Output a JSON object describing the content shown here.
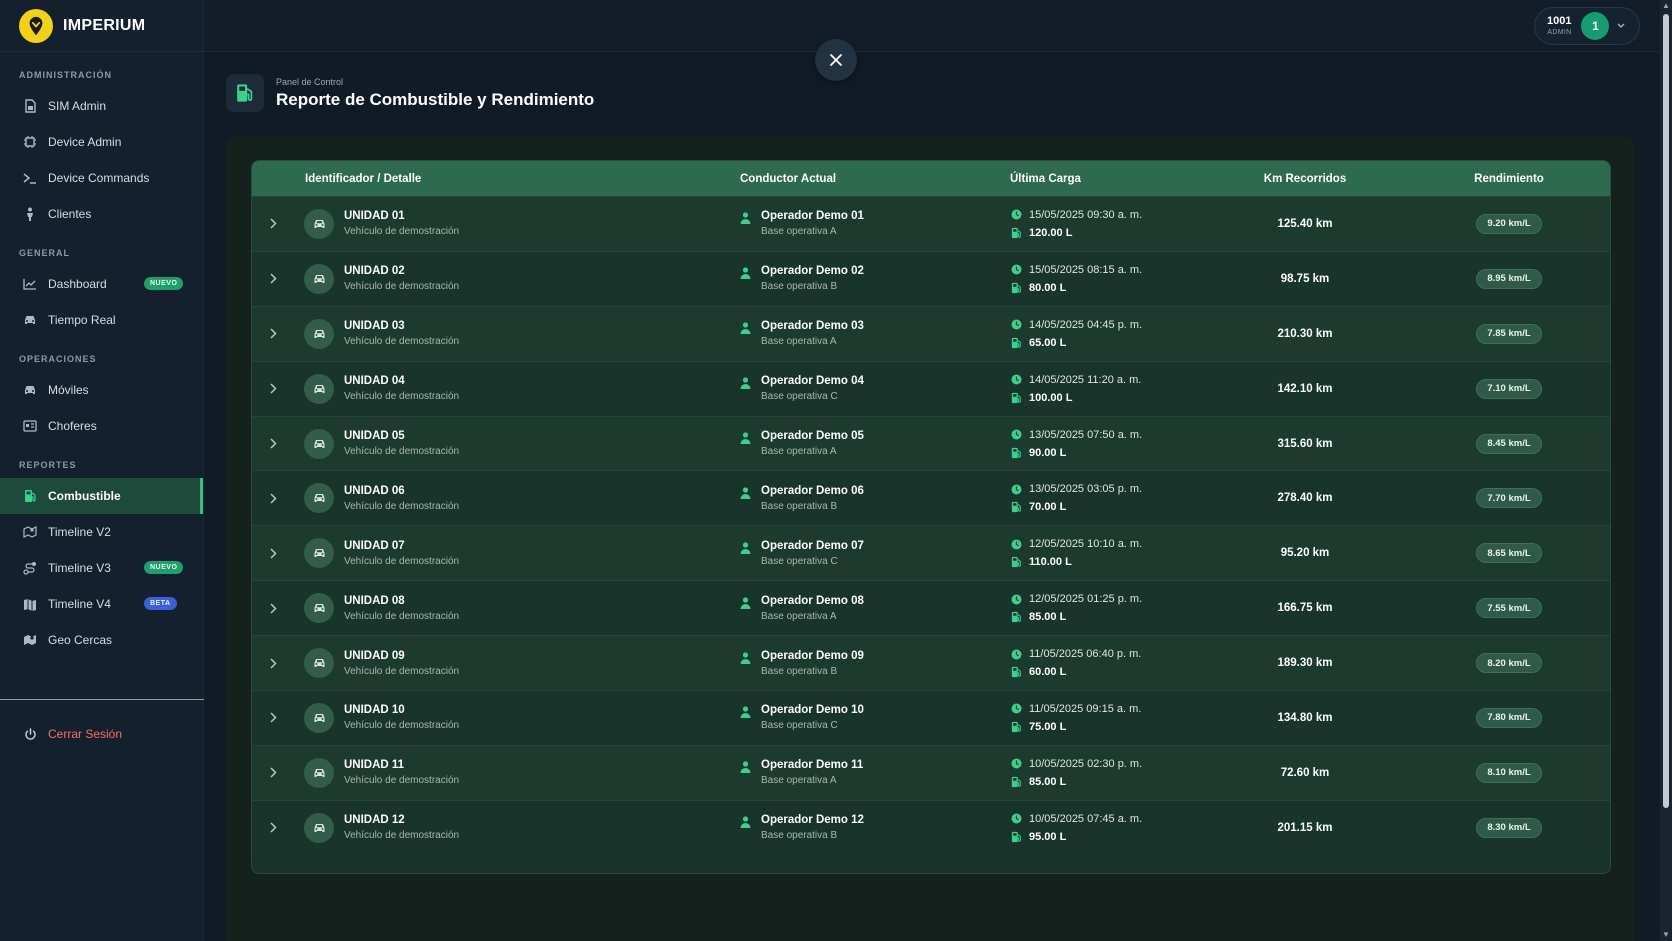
{
  "app": {
    "brand": "IMPERIUM"
  },
  "sidebar": {
    "sections": [
      {
        "label": "ADMINISTRACIÓN",
        "items": [
          {
            "label": "SIM Admin",
            "icon": "sim-card-icon"
          },
          {
            "label": "Device Admin",
            "icon": "chip-icon"
          },
          {
            "label": "Device Commands",
            "icon": "terminal-icon"
          },
          {
            "label": "Clientes",
            "icon": "person-icon"
          }
        ]
      },
      {
        "label": "GENERAL",
        "items": [
          {
            "label": "Dashboard",
            "icon": "chart-line-icon",
            "badge": "NUEVO"
          },
          {
            "label": "Tiempo Real",
            "icon": "car-icon"
          }
        ]
      },
      {
        "label": "OPERACIONES",
        "items": [
          {
            "label": "Móviles",
            "icon": "car-icon"
          },
          {
            "label": "Choferes",
            "icon": "id-card-icon"
          }
        ]
      },
      {
        "label": "REPORTES",
        "items": [
          {
            "label": "Combustible",
            "icon": "fuel-pump-icon",
            "active": true
          },
          {
            "label": "Timeline V2",
            "icon": "map-pin-icon"
          },
          {
            "label": "Timeline V3",
            "icon": "route-icon",
            "badge": "NUEVO"
          },
          {
            "label": "Timeline V4",
            "icon": "map-icon",
            "badge": "BETA"
          },
          {
            "label": "Geo Cercas",
            "icon": "geofence-icon"
          }
        ]
      }
    ],
    "logout_label": "Cerrar Sesión"
  },
  "user": {
    "id": "1001",
    "role": "ADMIN",
    "avatar_initial": "1"
  },
  "header": {
    "breadcrumb": "Panel de Control",
    "title": "Reporte de Combustible y Rendimiento"
  },
  "table": {
    "columns": [
      "Identificador / Detalle",
      "Conductor Actual",
      "Última Carga",
      "Km Recorridos",
      "Rendimiento"
    ],
    "rows": [
      {
        "unit": "UNIDAD 01",
        "detail": "Vehículo de demostración",
        "driver": "Operador Demo 01",
        "base": "Base operativa A",
        "date": "15/05/2025 09:30 a. m.",
        "liters": "120.00 L",
        "km": "125.40 km",
        "yield": "9.20 km/L"
      },
      {
        "unit": "UNIDAD 02",
        "detail": "Vehículo de demostración",
        "driver": "Operador Demo 02",
        "base": "Base operativa B",
        "date": "15/05/2025 08:15 a. m.",
        "liters": "80.00 L",
        "km": "98.75 km",
        "yield": "8.95 km/L"
      },
      {
        "unit": "UNIDAD 03",
        "detail": "Vehículo de demostración",
        "driver": "Operador Demo 03",
        "base": "Base operativa A",
        "date": "14/05/2025 04:45 p. m.",
        "liters": "65.00 L",
        "km": "210.30 km",
        "yield": "7.85 km/L"
      },
      {
        "unit": "UNIDAD 04",
        "detail": "Vehículo de demostración",
        "driver": "Operador Demo 04",
        "base": "Base operativa C",
        "date": "14/05/2025 11:20 a. m.",
        "liters": "100.00 L",
        "km": "142.10 km",
        "yield": "7.10 km/L"
      },
      {
        "unit": "UNIDAD 05",
        "detail": "Vehículo de demostración",
        "driver": "Operador Demo 05",
        "base": "Base operativa A",
        "date": "13/05/2025 07:50 a. m.",
        "liters": "90.00 L",
        "km": "315.60 km",
        "yield": "8.45 km/L"
      },
      {
        "unit": "UNIDAD 06",
        "detail": "Vehículo de demostración",
        "driver": "Operador Demo 06",
        "base": "Base operativa B",
        "date": "13/05/2025 03:05 p. m.",
        "liters": "70.00 L",
        "km": "278.40 km",
        "yield": "7.70 km/L"
      },
      {
        "unit": "UNIDAD 07",
        "detail": "Vehículo de demostración",
        "driver": "Operador Demo 07",
        "base": "Base operativa C",
        "date": "12/05/2025 10:10 a. m.",
        "liters": "110.00 L",
        "km": "95.20 km",
        "yield": "8.65 km/L"
      },
      {
        "unit": "UNIDAD 08",
        "detail": "Vehículo de demostración",
        "driver": "Operador Demo 08",
        "base": "Base operativa A",
        "date": "12/05/2025 01:25 p. m.",
        "liters": "85.00 L",
        "km": "166.75 km",
        "yield": "7.55 km/L"
      },
      {
        "unit": "UNIDAD 09",
        "detail": "Vehículo de demostración",
        "driver": "Operador Demo 09",
        "base": "Base operativa B",
        "date": "11/05/2025 06:40 p. m.",
        "liters": "60.00 L",
        "km": "189.30 km",
        "yield": "8.20 km/L"
      },
      {
        "unit": "UNIDAD 10",
        "detail": "Vehículo de demostración",
        "driver": "Operador Demo 10",
        "base": "Base operativa C",
        "date": "11/05/2025 09:15 a. m.",
        "liters": "75.00 L",
        "km": "134.80 km",
        "yield": "7.80 km/L"
      },
      {
        "unit": "UNIDAD 11",
        "detail": "Vehículo de demostración",
        "driver": "Operador Demo 11",
        "base": "Base operativa A",
        "date": "10/05/2025 02:30 p. m.",
        "liters": "85.00 L",
        "km": "72.60 km",
        "yield": "8.10 km/L"
      },
      {
        "unit": "UNIDAD 12",
        "detail": "Vehículo de demostración",
        "driver": "Operador Demo 12",
        "base": "Base operativa B",
        "date": "10/05/2025 07:45 a. m.",
        "liters": "95.00 L",
        "km": "201.15 km",
        "yield": "8.30 km/L"
      }
    ]
  },
  "colors": {
    "accent": "#2ec27e",
    "header_row": "#2d6a4f",
    "logout": "#ff6b6b",
    "brand_logo": "#f2d11a",
    "badge_new": "#1e9f6b",
    "badge_beta": "#3b5fd6"
  }
}
